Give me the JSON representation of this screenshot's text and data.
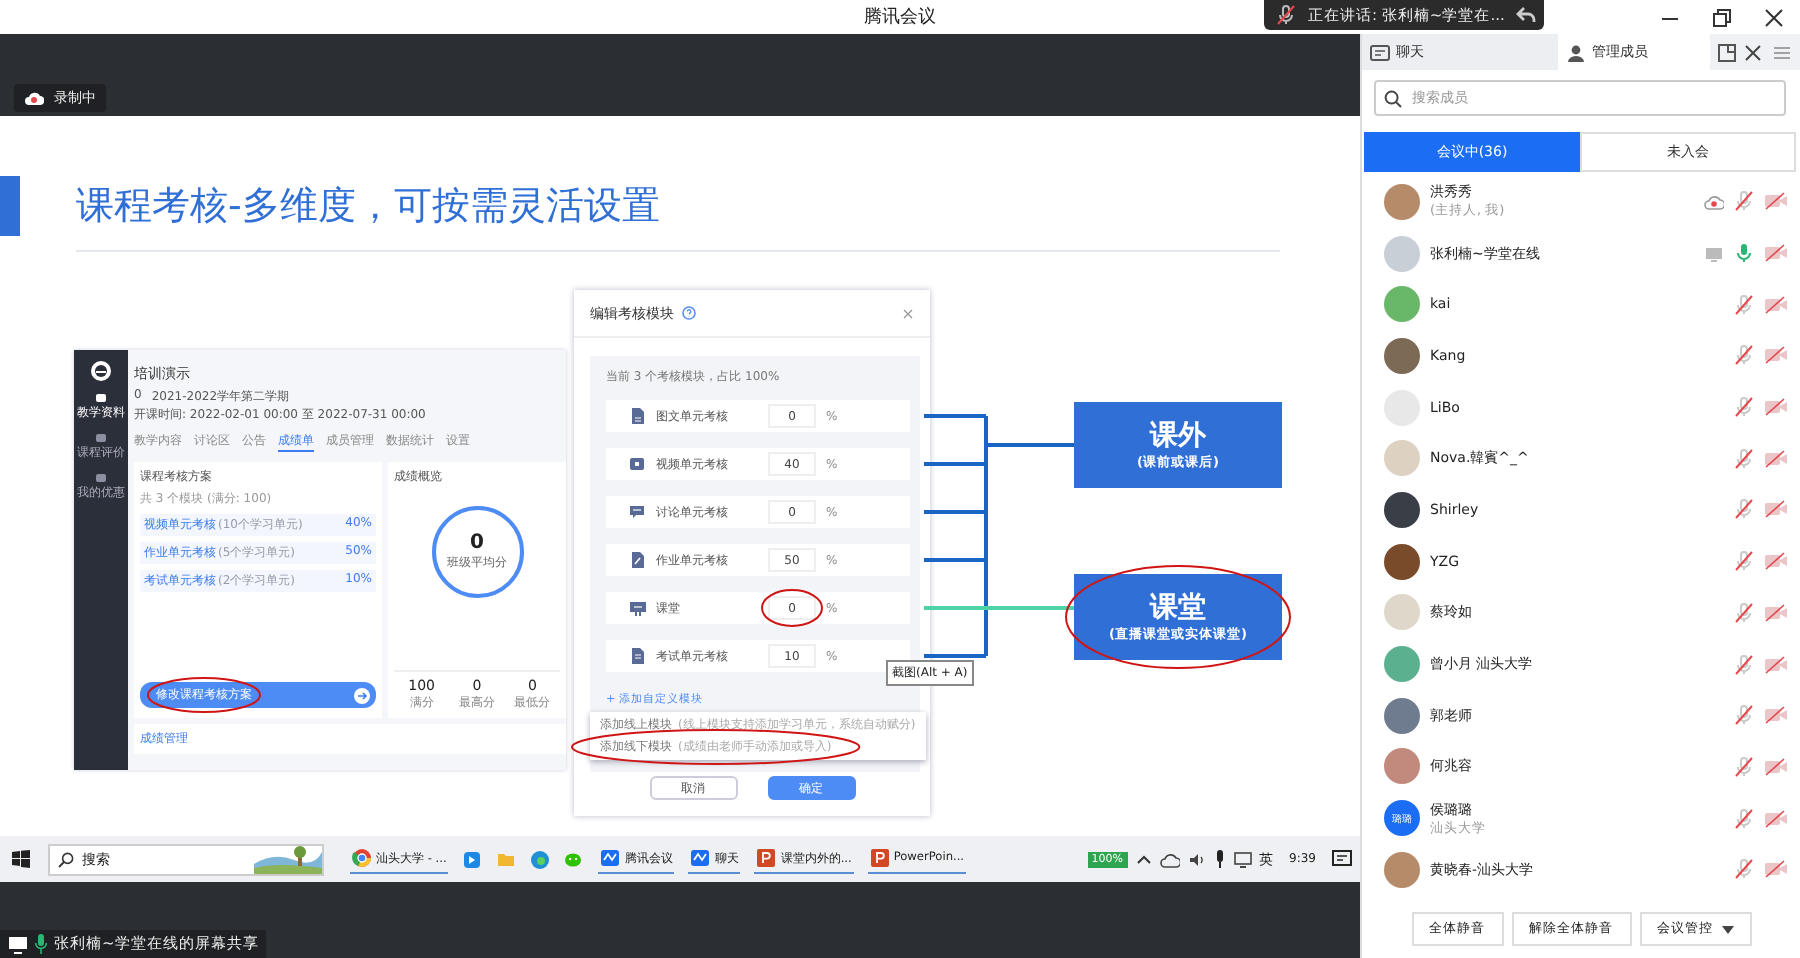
{
  "window": {
    "title": "腾讯会议"
  },
  "speaking": {
    "text": "正在讲话: 张利楠~学堂在..."
  },
  "recording": {
    "label": "录制中"
  },
  "shared_screen": {
    "slide": {
      "title": "课程考核-多维度，可按需灵活设置",
      "course_page": {
        "sidebar_items": [
          {
            "label": "教学资料",
            "selected": true
          },
          {
            "label": "课程评价",
            "selected": false
          },
          {
            "label": "我的优惠",
            "selected": false
          }
        ],
        "course_name": "培训演示",
        "meta": [
          "0",
          "2021-2022学年第二学期",
          "开课时间: 2022-02-01 00:00 至 2022-07-31 00:00"
        ],
        "tabs": [
          {
            "label": "教学内容",
            "selected": false
          },
          {
            "label": "讨论区",
            "selected": false
          },
          {
            "label": "公告",
            "selected": false
          },
          {
            "label": "成绩单",
            "selected": true
          },
          {
            "label": "成员管理",
            "selected": false
          },
          {
            "label": "数据统计",
            "selected": false
          },
          {
            "label": "设置",
            "selected": false
          }
        ],
        "scheme": {
          "title": "课程考核方案",
          "summary": "共 3 个模块 (满分: 100)",
          "items": [
            {
              "name": "视频单元考核",
              "detail": "(10个学习单元)",
              "share": "40%"
            },
            {
              "name": "作业单元考核",
              "detail": "(5个学习单元)",
              "share": "50%"
            },
            {
              "name": "考试单元考核",
              "detail": "(2个学习单元)",
              "share": "10%"
            }
          ],
          "button": "修改课程考核方案"
        },
        "overview": {
          "title": "成绩概览",
          "score": "0",
          "score_label": "班级平均分",
          "stats": [
            {
              "value": "100",
              "label": "满分"
            },
            {
              "value": "0",
              "label": "最高分"
            },
            {
              "value": "0",
              "label": "最低分"
            }
          ]
        },
        "footer": "成绩管理"
      },
      "dialog": {
        "title": "编辑考核模块",
        "summary": "当前 3 个考核模块，占比 100%",
        "modules": [
          {
            "kind": "document",
            "name": "图文单元考核",
            "value": "0",
            "unit": "%"
          },
          {
            "kind": "video",
            "name": "视频单元考核",
            "value": "40",
            "unit": "%"
          },
          {
            "kind": "discussion",
            "name": "讨论单元考核",
            "value": "0",
            "unit": "%"
          },
          {
            "kind": "assignment",
            "name": "作业单元考核",
            "value": "50",
            "unit": "%"
          },
          {
            "kind": "classroom",
            "name": "课堂",
            "value": "0",
            "unit": "%"
          },
          {
            "kind": "exam",
            "name": "考试单元考核",
            "value": "10",
            "unit": "%"
          }
        ],
        "add_link": "+ 添加自定义模块",
        "menu": [
          {
            "label": "添加线上模块",
            "hint": "(线上模块支持添加学习单元，系统自动赋分)"
          },
          {
            "label": "添加线下模块",
            "hint": "(成绩由老师手动添加或导入)"
          }
        ],
        "buttons": [
          {
            "label": "取消",
            "kind": "secondary"
          },
          {
            "label": "确定",
            "kind": "primary"
          }
        ]
      },
      "targets": [
        {
          "title": "课外",
          "subtitle": "(课前或课后)"
        },
        {
          "title": "课堂",
          "subtitle": "(直播课堂或实体课堂)"
        }
      ],
      "tooltip": "截图(Alt + A)"
    },
    "taskbar": {
      "search": {
        "placeholder": "搜索"
      },
      "apps": [
        {
          "kind": "browser",
          "label": "汕头大学 - ..."
        },
        {
          "kind": "app"
        },
        {
          "kind": "folder"
        },
        {
          "kind": "edge"
        },
        {
          "kind": "wechat"
        },
        {
          "kind": "meeting",
          "label": "腾讯会议"
        },
        {
          "kind": "meeting",
          "label": "聊天"
        },
        {
          "kind": "ppt",
          "label": "课堂内外的..."
        },
        {
          "kind": "ppt",
          "label": "PowerPoin..."
        }
      ],
      "battery": "100%",
      "ime": "英",
      "time": "9:39"
    },
    "share_label": "张利楠~学堂在线的屏幕共享"
  },
  "panel": {
    "tabs": [
      {
        "kind": "chat",
        "label": "聊天",
        "selected": false
      },
      {
        "kind": "members",
        "label": "管理成员",
        "selected": true
      }
    ],
    "search": {
      "placeholder": "搜索成员"
    },
    "segments": [
      {
        "label": "会议中(36)",
        "selected": true
      },
      {
        "label": "未入会",
        "selected": false
      }
    ],
    "members": [
      {
        "kind": "recording",
        "name": "洪秀秀",
        "subtitle": "(主持人, 我)",
        "mic_on": false,
        "camera_on": false
      },
      {
        "kind": "sharing",
        "name": "张利楠~学堂在线",
        "mic_on": true,
        "camera_on": false
      },
      {
        "kind": "plain",
        "name": "kai",
        "mic_on": false,
        "camera_on": false
      },
      {
        "kind": "plain",
        "name": "Kang",
        "mic_on": false,
        "camera_on": false
      },
      {
        "kind": "plain",
        "name": "LiBo",
        "mic_on": false,
        "camera_on": false
      },
      {
        "kind": "plain",
        "name": "Nova.韓賓^_^",
        "mic_on": false,
        "camera_on": false
      },
      {
        "kind": "plain",
        "name": "Shirley",
        "mic_on": false,
        "camera_on": false
      },
      {
        "kind": "plain",
        "name": "YZG",
        "mic_on": false,
        "camera_on": false
      },
      {
        "kind": "plain",
        "name": "蔡玲如",
        "mic_on": false,
        "camera_on": false
      },
      {
        "kind": "plain",
        "name": "曾小月 汕头大学",
        "mic_on": false,
        "camera_on": false
      },
      {
        "kind": "plain",
        "name": "郭老师",
        "mic_on": false,
        "camera_on": false
      },
      {
        "kind": "plain",
        "name": "何兆容",
        "mic_on": false,
        "camera_on": false
      },
      {
        "kind": "plain",
        "name": "侯璐璐",
        "subtitle": "汕头大学",
        "avatar_text": "璐璐",
        "mic_on": false,
        "camera_on": false
      },
      {
        "kind": "plain",
        "name": "黄晓春-汕头大学",
        "mic_on": false,
        "camera_on": false
      }
    ],
    "buttons": [
      {
        "label": "全体静音",
        "kind": "plain"
      },
      {
        "label": "解除全体静音",
        "kind": "plain"
      },
      {
        "label": "会议管控",
        "kind": "menu"
      }
    ]
  }
}
